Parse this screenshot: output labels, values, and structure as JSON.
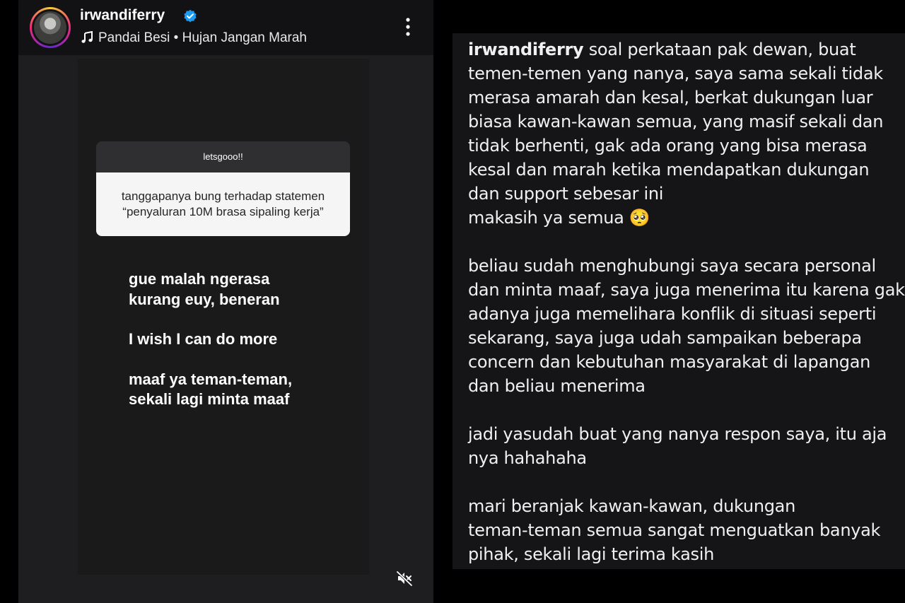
{
  "story": {
    "username": "irwandiferry",
    "track": "Pandai Besi • Hujan Jangan Marah",
    "question": {
      "header": "letsgooo!!",
      "line1": "tanggapanya bung terhadap statemen",
      "line2": "“penyaluran 10M brasa sipaling kerja”"
    },
    "text": {
      "l1": "gue malah ngerasa",
      "l2": "kurang euy, beneran",
      "l3": "I wish I can do more",
      "l4": "maaf ya teman-teman,",
      "l5": "sekali lagi minta maaf"
    }
  },
  "caption": {
    "username": "irwandiferry",
    "first_rest": " soal perkataan pak dewan, buat",
    "lines": [
      "temen-temen yang nanya, saya sama sekali tidak",
      "merasa amarah dan kesal, berkat dukungan luar",
      "biasa kawan-kawan semua, yang masif sekali dan",
      "tidak berhenti, gak ada orang yang bisa merasa",
      "kesal dan marah ketika mendapatkan dukungan",
      "dan support sebesar ini",
      "makasih ya semua 🥺",
      "beliau sudah menghubungi saya secara personal",
      "dan minta maaf, saya juga menerima itu karena gak",
      "adanya juga memelihara konflik di situasi seperti",
      "sekarang, saya juga udah sampaikan beberapa",
      "concern dan kebutuhan masyarakat di lapangan",
      "dan beliau menerima",
      "jadi yasudah buat yang nanya respon saya, itu aja",
      "nya hahahaha",
      "mari beranjak kawan-kawan, dukungan",
      "teman-teman semua sangat menguatkan banyak",
      "pihak, sekali lagi terima kasih"
    ]
  },
  "colors": {
    "verified": "#1d9bf0",
    "background": "#000000"
  },
  "icons": [
    "verified-badge-icon",
    "music-note-icon",
    "more-vertical-icon",
    "muted-speaker-icon"
  ]
}
